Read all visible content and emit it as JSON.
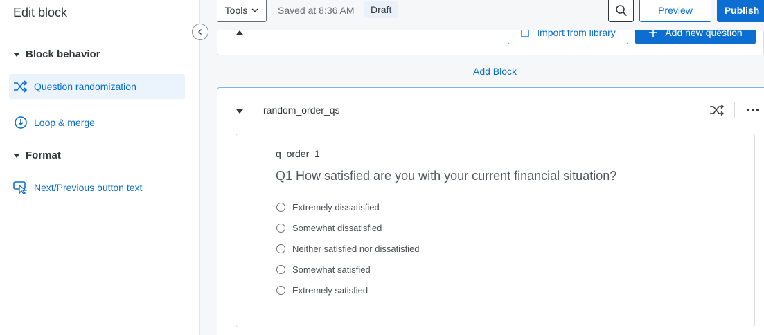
{
  "sidebar": {
    "title": "Edit block",
    "sections": [
      {
        "label": "Block behavior"
      },
      {
        "label": "Format"
      }
    ],
    "items": [
      {
        "label": "Question randomization",
        "icon": "shuffle-icon",
        "active": true
      },
      {
        "label": "Loop & merge",
        "icon": "loop-icon",
        "active": false
      },
      {
        "label": "Next/Previous button text",
        "icon": "cursor-click-icon",
        "active": false
      }
    ]
  },
  "toolbar": {
    "tools_label": "Tools",
    "saved_status": "Saved at 8:36 AM",
    "draft_badge": "Draft",
    "preview_label": "Preview",
    "publish_label": "Publish"
  },
  "prev_block": {
    "import_label": "Import from library",
    "add_question_label": "Add new question"
  },
  "add_block_label": "Add Block",
  "block": {
    "name": "random_order_qs",
    "question": {
      "id": "q_order_1",
      "text": "Q1 How satisfied are you with your current financial situation?",
      "choices": [
        "Extremely dissatisfied",
        "Somewhat dissatisfied",
        "Neither satisfied nor dissatisfied",
        "Somewhat satisfied",
        "Extremely satisfied"
      ]
    }
  },
  "colors": {
    "accent": "#0b6ed0",
    "active_bg": "#ebf3fc",
    "block_border": "#82b4e8"
  }
}
